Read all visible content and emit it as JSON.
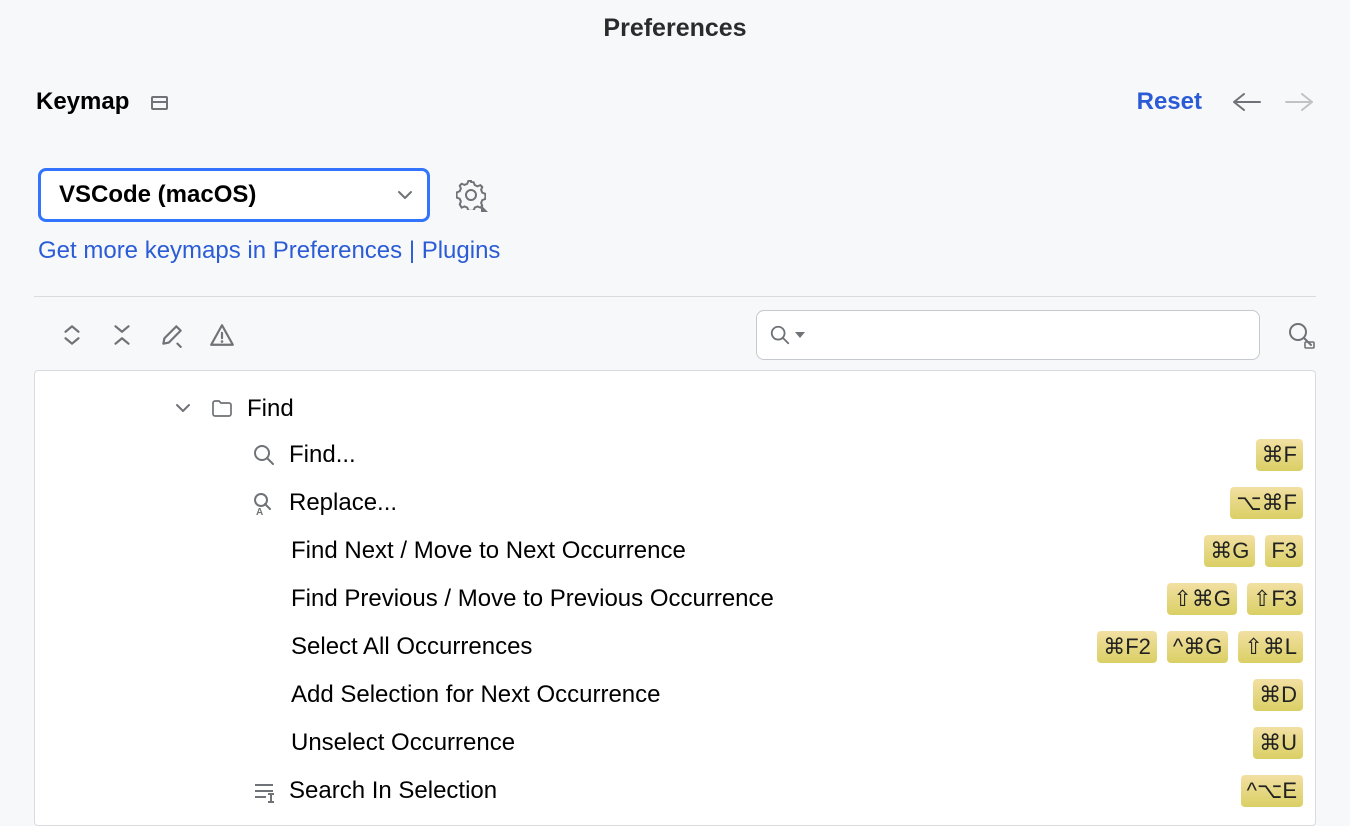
{
  "window_title": "Preferences",
  "section": {
    "title": "Keymap",
    "reset_label": "Reset"
  },
  "keymap_selector": {
    "current": "VSCode (macOS)",
    "more_link": "Get more keymaps in Preferences | Plugins"
  },
  "search": {
    "value": ""
  },
  "tree": {
    "group": {
      "label": "Find",
      "expanded": true
    },
    "items": [
      {
        "icon": "search",
        "label": "Find...",
        "shortcuts": [
          "⌘F"
        ]
      },
      {
        "icon": "replace",
        "label": "Replace...",
        "shortcuts": [
          "⌥⌘F"
        ]
      },
      {
        "icon": "",
        "label": "Find Next / Move to Next Occurrence",
        "shortcuts": [
          "⌘G",
          "F3"
        ]
      },
      {
        "icon": "",
        "label": "Find Previous / Move to Previous Occurrence",
        "shortcuts": [
          "⇧⌘G",
          "⇧F3"
        ]
      },
      {
        "icon": "",
        "label": "Select All Occurrences",
        "shortcuts": [
          "⌘F2",
          "^⌘G",
          "⇧⌘L"
        ]
      },
      {
        "icon": "",
        "label": "Add Selection for Next Occurrence",
        "shortcuts": [
          "⌘D"
        ]
      },
      {
        "icon": "",
        "label": "Unselect Occurrence",
        "shortcuts": [
          "⌘U"
        ]
      },
      {
        "icon": "selection",
        "label": "Search In Selection",
        "shortcuts": [
          "^⌥E"
        ]
      }
    ]
  }
}
